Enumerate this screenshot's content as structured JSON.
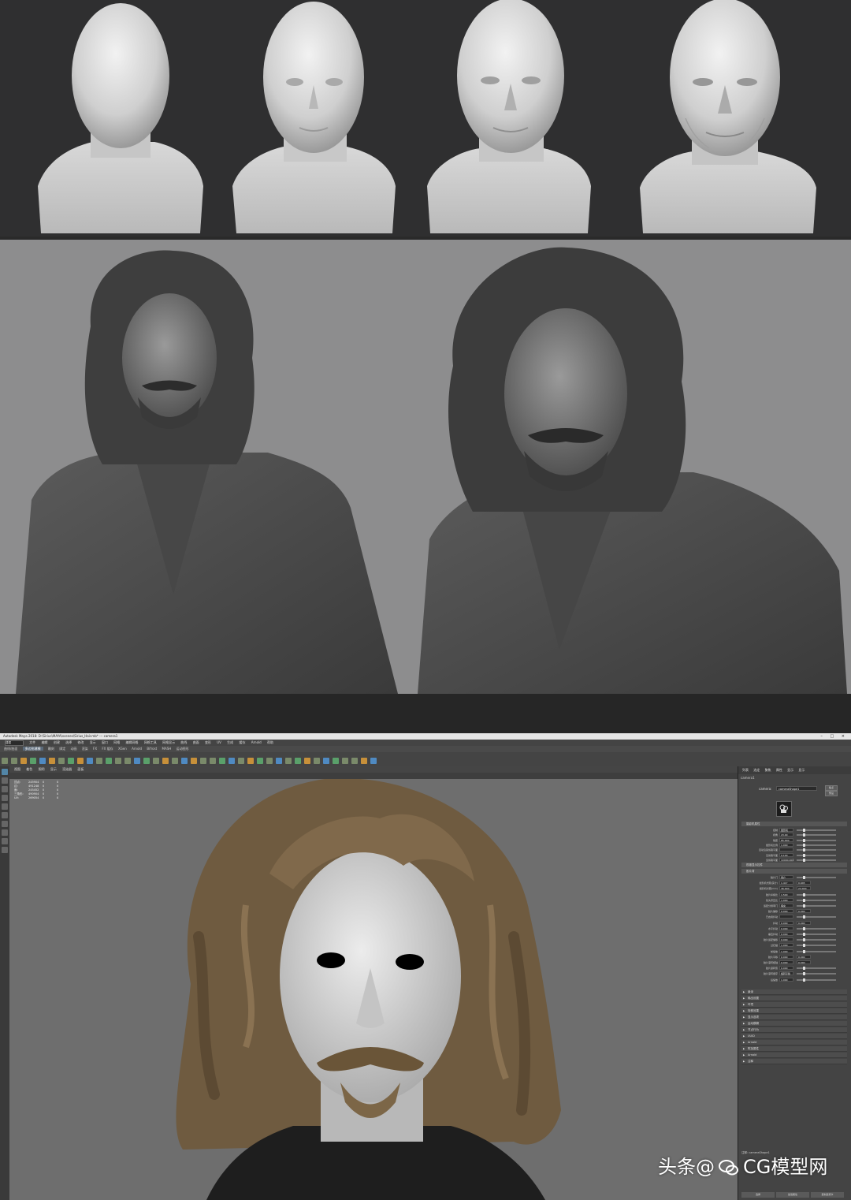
{
  "app": {
    "title": "Autodesk Maya 2018: D:\\Sirius\\MAYA\\scenes\\Sirius_Hair.mb* --- camera1",
    "window_buttons": "– □ ×",
    "menus": [
      "文件",
      "编辑",
      "创建",
      "选择",
      "修改",
      "显示",
      "窗口",
      "网格",
      "编辑网格",
      "网格工具",
      "网格显示",
      "曲线",
      "曲面",
      "变形",
      "UV",
      "生成",
      "缓存",
      "Arnold",
      "帮助"
    ],
    "mode": "建模",
    "shelf_tabs": [
      "曲线/曲面",
      "多边形建模",
      "雕刻",
      "绑定",
      "动画",
      "渲染",
      "FX",
      "FX 缓存",
      "XGen",
      "Arnold",
      "Bifrost",
      "MASH",
      "运动图形"
    ],
    "shelf_active": "多边形建模"
  },
  "viewport": {
    "menus": [
      "视图",
      "着色",
      "照明",
      "显示",
      "渲染器",
      "面板"
    ],
    "hud": [
      [
        "顶点:",
        "245904",
        "0",
        "0"
      ],
      [
        "边:",
        "491248",
        "0",
        "0"
      ],
      [
        "面:",
        "245452",
        "0",
        "0"
      ],
      [
        "三角形:",
        "490904",
        "0",
        "0"
      ],
      [
        "UV:",
        "269054",
        "0",
        "0"
      ]
    ]
  },
  "attribute_editor": {
    "tabs": [
      "列表",
      "选定",
      "聚焦",
      "属性",
      "显示",
      "显示"
    ],
    "node_tab": "camera1",
    "node_label": "camera:",
    "node_value": "cameraShape1",
    "focus_btn": "焦点",
    "preset_btn": "预设",
    "sections": {
      "camera_attrs": "摄影机属性",
      "frustum": "视锥显示控件",
      "film_back": "胶片背"
    },
    "camera_props": [
      {
        "label": "控制",
        "value": "摄影机"
      },
      {
        "label": "视角",
        "value": "23.00"
      },
      {
        "label": "焦距",
        "value": "85.000"
      },
      {
        "label": "摄影机比例",
        "value": "1.000"
      },
      {
        "label": "自动渲染剪裁平面",
        "value": ""
      },
      {
        "label": "近剪裁平面",
        "value": "0.100"
      },
      {
        "label": "远剪裁平面",
        "value": "10000.000"
      }
    ],
    "film_props": [
      {
        "label": "胶片门",
        "value": "用户"
      },
      {
        "label": "摄影机光圈(英寸)",
        "value": "1.417",
        "value2": "0.945"
      },
      {
        "label": "摄影机光圈(mm)",
        "value": "36.000",
        "value2": "24.000"
      },
      {
        "label": "胶片纵横比",
        "value": "1.500"
      },
      {
        "label": "镜头挤压比",
        "value": "1.000"
      },
      {
        "label": "适配分辨率门",
        "value": "填充"
      },
      {
        "label": "胶片偏移",
        "value": "0.000",
        "value2": "0.000"
      },
      {
        "label": "已启用抖动",
        "value": ""
      },
      {
        "label": "抖动",
        "value": "0.000",
        "value2": "0.000"
      },
      {
        "label": "水平抖动",
        "value": "0.000"
      },
      {
        "label": "垂直抖动",
        "value": "0.000"
      },
      {
        "label": "胶片适配偏移",
        "value": "0.000"
      },
      {
        "label": "过扫描",
        "value": "1.000"
      },
      {
        "label": "前缩放",
        "value": "1.000"
      },
      {
        "label": "胶片平移",
        "value": "0.000",
        "value2": "0.000"
      },
      {
        "label": "胶片滚转枢轴",
        "value": "0.000",
        "value2": "0.000"
      },
      {
        "label": "胶片滚转值",
        "value": "0.000"
      },
      {
        "label": "胶片滚转顺序",
        "value": "旋转平移"
      },
      {
        "label": "后缩放",
        "value": "1.000"
      }
    ],
    "collapsed": [
      "景深",
      "输出设置",
      "环境",
      "特殊效果",
      "显示选项",
      "运动模糊",
      "节点行为",
      "UUID",
      "Arnold",
      "附加属性",
      "Arnold",
      "注释"
    ],
    "notes_label": "注释: cameraShape1",
    "bottom_buttons": [
      "选择",
      "加载属性",
      "复制选项卡"
    ]
  },
  "watermark": {
    "prefix": "头条",
    "at": "@",
    "name": "CG模型网"
  },
  "colors": {
    "top_bg": "#2f2f30",
    "mid_bg": "#8d8d8e",
    "viewport_bg": "#6e6e6e",
    "hair": "#7a6447",
    "skin": "#d9d9d9"
  }
}
